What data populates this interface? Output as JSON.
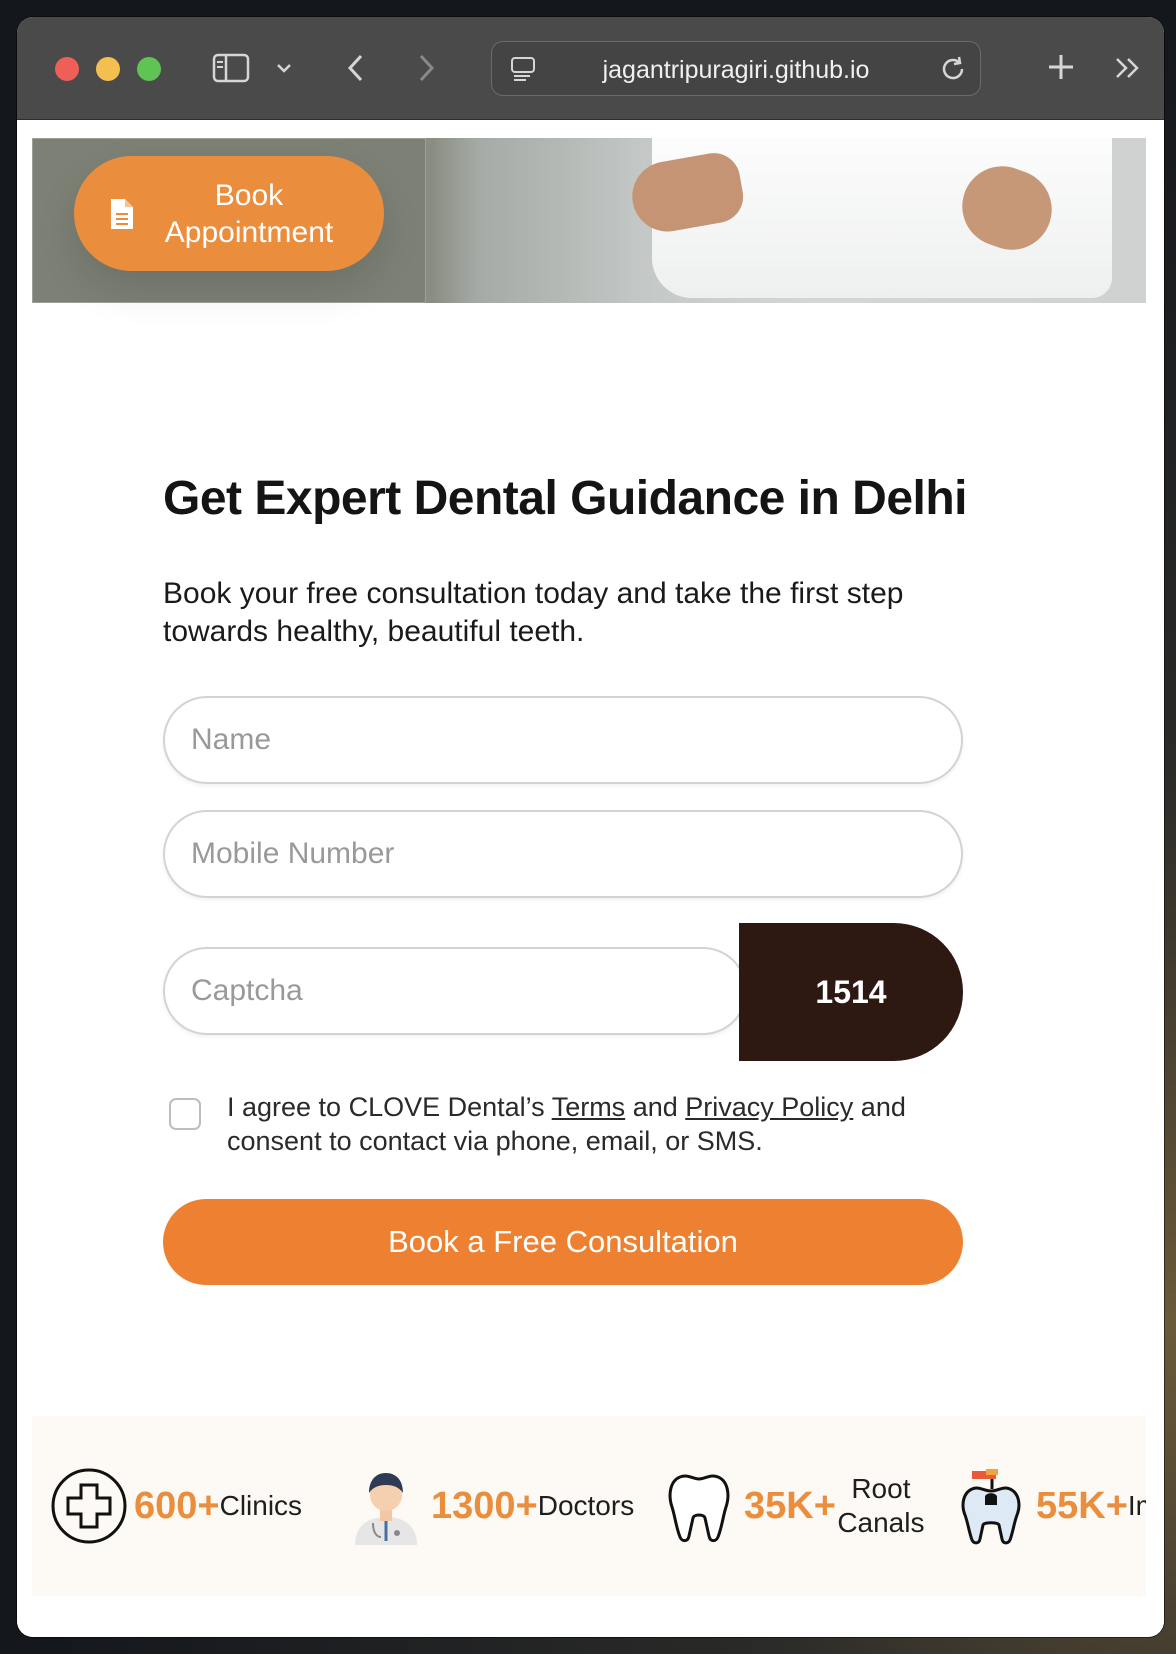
{
  "browser": {
    "url": "jagantripuragiri.github.io"
  },
  "hero": {
    "book_label": "Book Appointment"
  },
  "form": {
    "heading": "Get Expert Dental Guidance in Delhi",
    "subtext": "Book your free consultation today and take the first step towards healthy, beautiful teeth.",
    "name_placeholder": "Name",
    "mobile_placeholder": "Mobile Number",
    "captcha_placeholder": "Captcha",
    "captcha_code": "1514",
    "consent_prefix": "I agree to CLOVE Dental’s ",
    "terms_link": "Terms",
    "consent_and": " and ",
    "privacy_link": "Privacy Policy",
    "consent_suffix": " and consent to contact via phone, email, or SMS.",
    "submit_label": "Book a Free Consultation"
  },
  "stats": [
    {
      "value": "600+",
      "label": "Clinics",
      "icon": "medical-cross-icon"
    },
    {
      "value": "1300+",
      "label": "Doctors",
      "icon": "doctor-icon"
    },
    {
      "value": "35K+",
      "label": "Root Canals",
      "icon": "tooth-icon"
    },
    {
      "value": "55K+",
      "label": "Impla",
      "icon": "implant-icon"
    }
  ],
  "colors": {
    "accent": "#ee8131",
    "captcha_bg": "#2d1911",
    "stats_bg": "#fdf9f4"
  }
}
